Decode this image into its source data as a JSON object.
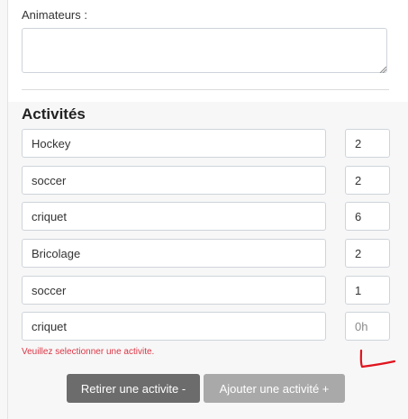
{
  "form": {
    "animateurs_label": "Animateurs :",
    "animateurs_value": "",
    "activities_title": "Activités",
    "activities": [
      {
        "name": "Hockey",
        "qty": "2"
      },
      {
        "name": "soccer",
        "qty": "2"
      },
      {
        "name": "criquet",
        "qty": "6"
      },
      {
        "name": "Bricolage",
        "qty": "2"
      },
      {
        "name": "soccer",
        "qty": "1"
      },
      {
        "name": "criquet",
        "qty": "",
        "qty_placeholder": "0h"
      }
    ],
    "error_message": "Veuillez selectionner une activite.",
    "remove_button": "Retirer une activite -",
    "add_button": "Ajouter une activité +"
  },
  "colors": {
    "error": "#dc3545",
    "annotation": "#e0141e",
    "remove_button_bg": "#6c6c6c",
    "add_button_bg": "#a9a9a9"
  }
}
